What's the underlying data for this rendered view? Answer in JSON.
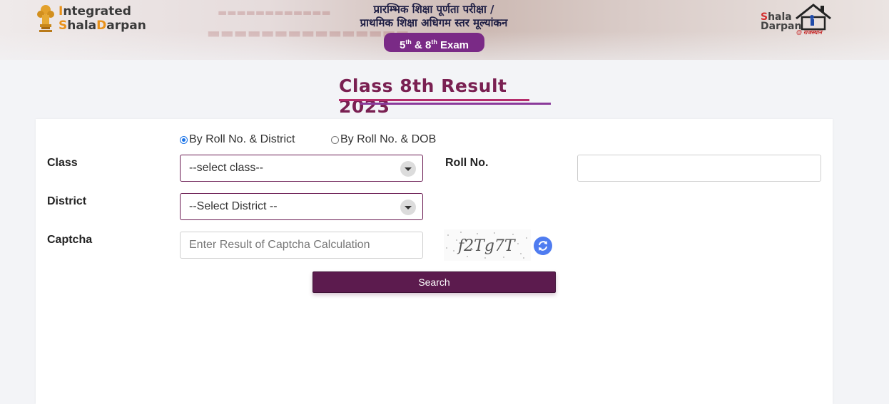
{
  "header": {
    "brand_line1_accent": "I",
    "brand_line1_rest": "ntegrated",
    "brand_line2_accent1": "S",
    "brand_line2_mid": "hala",
    "brand_line2_accent2": "D",
    "brand_line2_rest": "arpan",
    "title_line1": "प्रारम्भिक शिक्षा पूर्णता परीक्षा /",
    "title_line2": "प्राथमिक शिक्षा अधिगम स्तर मूल्यांकन",
    "exam_badge_a": "5",
    "exam_badge_a_sup": "th",
    "exam_badge_mid": " & 8",
    "exam_badge_b_sup": "th",
    "exam_badge_tail": " Exam",
    "right_logo_line1_accent": "S",
    "right_logo_line1_rest": "hala",
    "right_logo_line2": "Darpan",
    "right_logo_sub": "@ राजस्थान"
  },
  "page": {
    "title": "Class 8th Result 2023"
  },
  "form": {
    "radio_roll_district": "By Roll No. & District",
    "radio_roll_dob": "By Roll No. & DOB",
    "selected_radio": "roll_district",
    "class_label": "Class",
    "class_select_value": "--select class--",
    "roll_label": "Roll No.",
    "roll_value": "",
    "district_label": "District",
    "district_select_value": "--Select District --",
    "captcha_label": "Captcha",
    "captcha_placeholder": "Enter Result of Captcha Calculation",
    "captcha_text": "f2Tg7T",
    "search_label": "Search"
  },
  "colors": {
    "primary": "#5c1b4e",
    "title": "#7a2052",
    "badge": "#7a2a86",
    "refresh": "#4f7cf0"
  },
  "icons": {
    "emblem": "state-emblem-icon",
    "refresh": "refresh-icon",
    "dropdown": "chevron-down-icon",
    "house": "house-logo-icon"
  }
}
